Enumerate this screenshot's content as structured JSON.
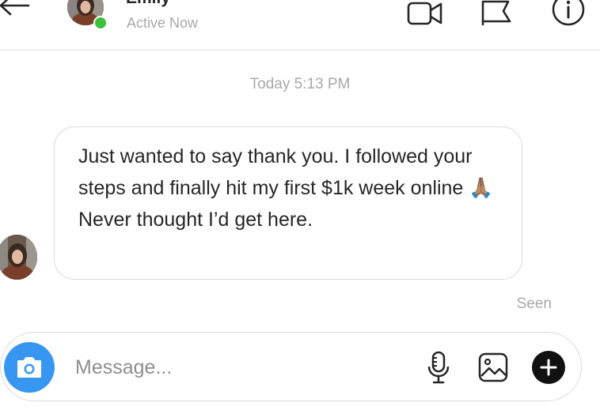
{
  "header": {
    "contact_name": "Emily",
    "status": "Active Now",
    "back_icon": "back-arrow-icon",
    "icons": [
      "video-call-icon",
      "flag-icon",
      "info-icon"
    ]
  },
  "conversation": {
    "timestamp": "Today 5:13 PM",
    "messages": [
      {
        "text": "Just wanted to say thank you. I followed your steps and finally hit my first $1k week online 🙏🏽 Never thought I’d get here.",
        "sender": "Emily"
      }
    ],
    "seen_label": "Seen"
  },
  "composer": {
    "placeholder": "Message...",
    "value": "",
    "icons": [
      "camera-icon",
      "microphone-icon",
      "image-icon",
      "add-icon"
    ]
  },
  "colors": {
    "online": "#3cc13b",
    "camera_button": "#3797f0",
    "muted_text": "#a8a8a8",
    "border": "#dbdbdb"
  }
}
